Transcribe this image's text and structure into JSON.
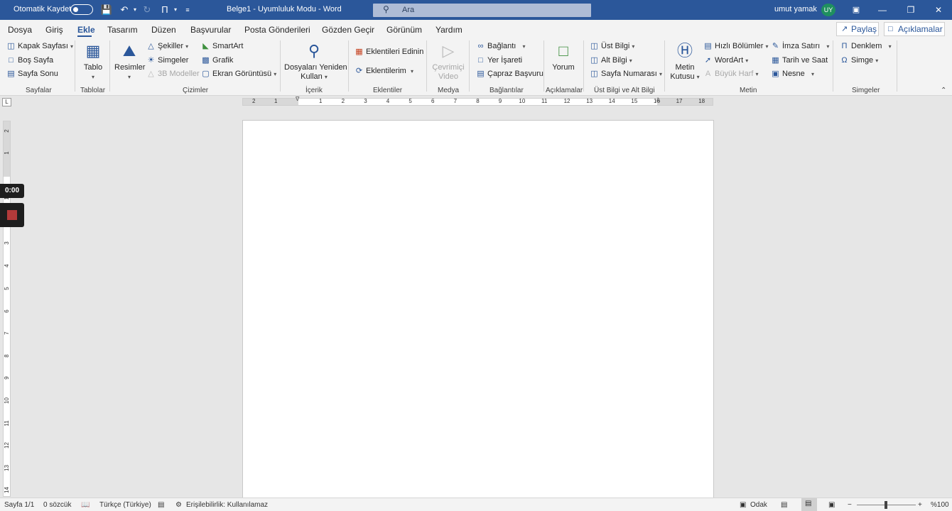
{
  "titlebar": {
    "autosave_label": "Otomatik Kaydet",
    "doc_title": "Belge1 - Uyumluluk Modu - Word",
    "search_placeholder": "Ara",
    "user_name": "umut yamak",
    "user_initials": "UY"
  },
  "tabs": [
    "Dosya",
    "Giriş",
    "Ekle",
    "Tasarım",
    "Düzen",
    "Başvurular",
    "Posta Gönderileri",
    "Gözden Geçir",
    "Görünüm",
    "Yardım"
  ],
  "active_tab": "Ekle",
  "share_label": "Paylaş",
  "comments_label": "Açıklamalar",
  "ribbon": {
    "sayfalar": {
      "label": "Sayfalar",
      "items": [
        "Kapak Sayfası",
        "Boş Sayfa",
        "Sayfa Sonu"
      ]
    },
    "tablolar": {
      "label": "Tablolar",
      "tablo": "Tablo"
    },
    "cizimler": {
      "label": "Çizimler",
      "resimler": "Resimler",
      "items": [
        "Şekiller",
        "Simgeler",
        "3B Modeller"
      ],
      "items2": [
        "SmartArt",
        "Grafik",
        "Ekran Görüntüsü"
      ]
    },
    "icerik": {
      "label": "İçerik",
      "line1": "Dosyaları Yeniden",
      "line2": "Kullan"
    },
    "eklentiler": {
      "label": "Eklentiler",
      "items": [
        "Eklentileri Edinin",
        "Eklentilerim"
      ]
    },
    "medya": {
      "label": "Medya",
      "line1": "Çevrimiçi",
      "line2": "Video"
    },
    "baglantilar": {
      "label": "Bağlantılar",
      "items": [
        "Bağlantı",
        "Yer İşareti",
        "Çapraz Başvuru"
      ]
    },
    "aciklamalar": {
      "label": "Açıklamalar",
      "yorum": "Yorum"
    },
    "ustalt": {
      "label": "Üst Bilgi ve Alt Bilgi",
      "items": [
        "Üst Bilgi",
        "Alt Bilgi",
        "Sayfa Numarası"
      ]
    },
    "metin": {
      "label": "Metin",
      "line1": "Metin",
      "line2": "Kutusu",
      "items": [
        "Hızlı Bölümler",
        "WordArt",
        "Büyük Harf"
      ],
      "items2": [
        "İmza Satırı",
        "Tarih ve Saat",
        "Nesne"
      ]
    },
    "simgeler": {
      "label": "Simgeler",
      "items": [
        "Denklem",
        "Simge"
      ]
    }
  },
  "ruler": {
    "h_left": [
      "2",
      "1"
    ],
    "h_right": [
      "1",
      "2",
      "3",
      "4",
      "5",
      "6",
      "7",
      "8",
      "9",
      "10",
      "11",
      "12",
      "13",
      "14",
      "15",
      "16",
      "17",
      "18"
    ],
    "v": [
      "2",
      "1",
      "1",
      "2",
      "3",
      "4",
      "5",
      "6",
      "7",
      "8",
      "9",
      "10",
      "11",
      "12",
      "13",
      "14"
    ]
  },
  "recorder": {
    "timer": "0:00"
  },
  "status": {
    "page": "Sayfa 1/1",
    "words": "0 sözcük",
    "language": "Türkçe (Türkiye)",
    "accessibility": "Erişilebilirlik: Kullanılamaz",
    "focus": "Odak",
    "zoom": "%100"
  }
}
